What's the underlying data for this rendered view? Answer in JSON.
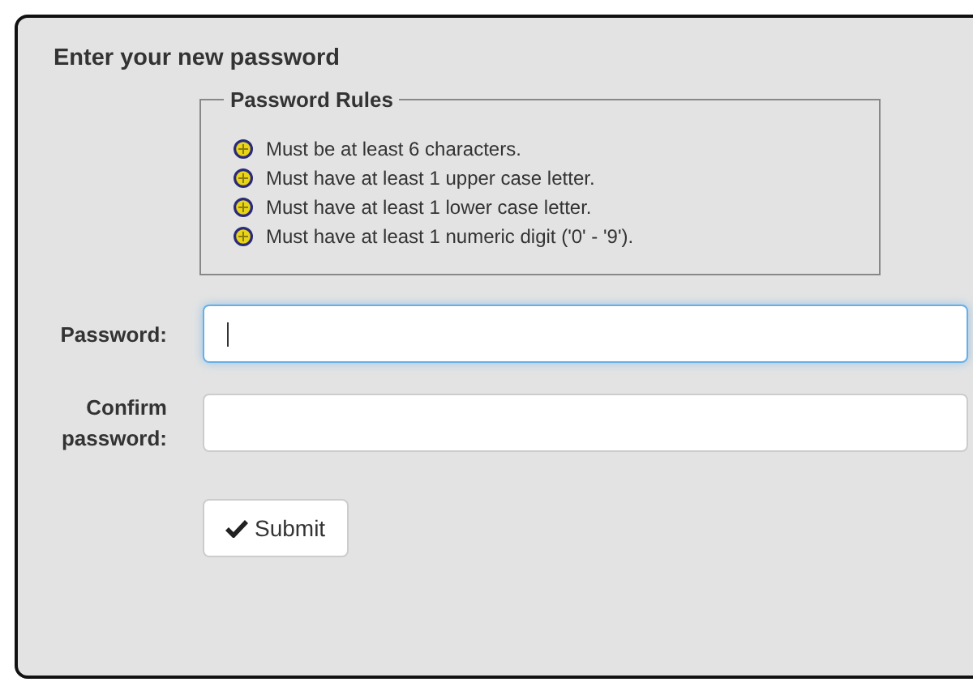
{
  "title": "Enter your new password",
  "rules": {
    "legend": "Password Rules",
    "items": [
      "Must be at least 6 characters.",
      "Must have at least 1 upper case letter.",
      "Must have at least 1 lower case letter.",
      "Must have at least 1 numeric digit ('0' - '9')."
    ]
  },
  "fields": [
    {
      "label": "Password:",
      "focused": true
    },
    {
      "label": "Confirm password:",
      "focused": false
    }
  ],
  "submit": {
    "label": "Submit"
  }
}
